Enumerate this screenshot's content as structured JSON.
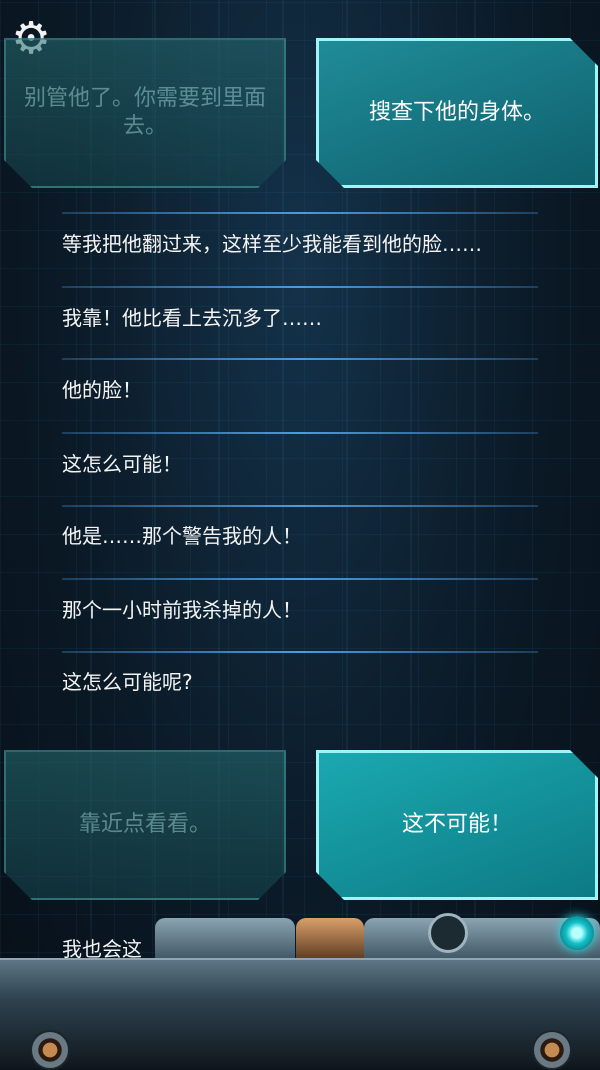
{
  "settings": {
    "icon": "gear-icon"
  },
  "choices_top": {
    "left": "别管他了。你需要到里面去。",
    "right": "搜查下他的身体。"
  },
  "messages": [
    "等我把他翻过来，这样至少我能看到他的脸……",
    "我靠！他比看上去沉多了……",
    "他的脸！",
    "这怎么可能！",
    "他是……那个警告我的人！",
    "那个一小时前我杀掉的人！",
    "这怎么可能呢?"
  ],
  "choices_bottom": {
    "left": "靠近点看看。",
    "right": "这不可能！"
  },
  "partial_message": "我也会这",
  "colors": {
    "accent": "#9ff5f6",
    "choice_active": "#1f8c98",
    "separator": "#4a9be0"
  }
}
